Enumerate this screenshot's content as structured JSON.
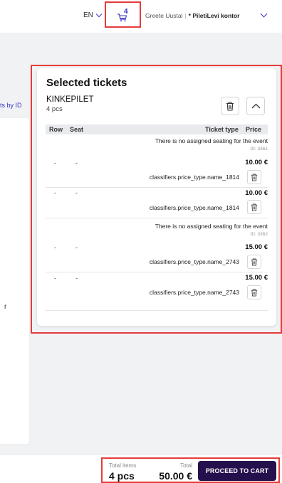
{
  "header": {
    "language": "EN",
    "cart_count": "4",
    "user_name": "Greete Uustal",
    "separator": "|",
    "organization": "* PiletiLevi kontor"
  },
  "left": {
    "link_text": "ts by ID",
    "partial_text": "r"
  },
  "card": {
    "title": "Selected tickets",
    "group": {
      "name": "KINKEPILET",
      "count": "4 pcs"
    },
    "columns": {
      "row": "Row",
      "seat": "Seat",
      "type": "Ticket type",
      "price": "Price"
    },
    "sections": [
      {
        "note": "There is no assigned seating for the event",
        "id": "ID: 3361",
        "tickets": [
          {
            "row": "-",
            "seat": "-",
            "price": "10.00 €",
            "type": "classifiers.price_type.name_1814"
          },
          {
            "row": "-",
            "seat": "-",
            "price": "10.00 €",
            "type": "classifiers.price_type.name_1814"
          }
        ]
      },
      {
        "note": "There is no assigned seating for the event",
        "id": "ID: 3362",
        "tickets": [
          {
            "row": "-",
            "seat": "-",
            "price": "15.00 €",
            "type": "classifiers.price_type.name_2743"
          },
          {
            "row": "-",
            "seat": "-",
            "price": "15.00 €",
            "type": "classifiers.price_type.name_2743"
          }
        ]
      }
    ]
  },
  "footer": {
    "total_items_label": "Total items",
    "total_items_value": "4 pcs",
    "total_label": "Total",
    "total_value": "50.00 €",
    "proceed_label": "PROCEED TO CART"
  },
  "colors": {
    "accent": "#3b33c7",
    "primary_button": "#25104e",
    "highlight": "#e53b3b"
  }
}
